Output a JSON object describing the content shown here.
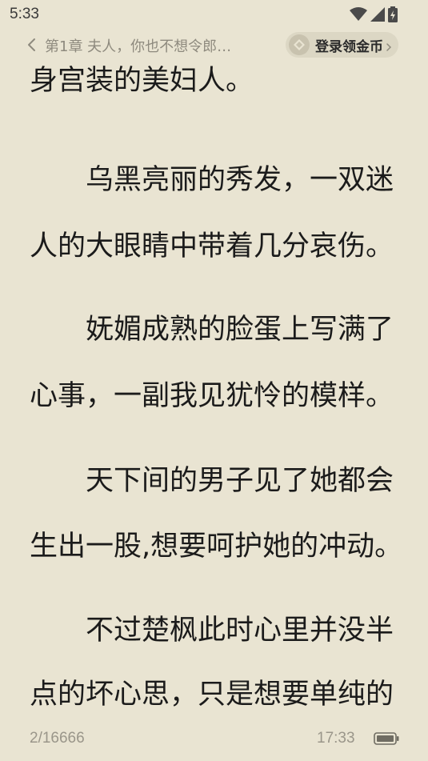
{
  "status_bar": {
    "time": "5:33",
    "icons": [
      "wifi-icon",
      "signal-icon",
      "battery-charging-icon"
    ]
  },
  "header": {
    "chapter_title": "第1章 夫人，你也不想令郎…",
    "login_button": "登录领金币"
  },
  "content": {
    "lines": [
      "身宫装的美妇人。",
      "乌黑亮丽的秀发，一双迷",
      "人的大眼睛中带着几分哀伤。",
      "妩媚成熟的脸蛋上写满了",
      "心事，一副我见犹怜的模样。",
      "天下间的男子见了她都会",
      "生出一股,想要呵护她的冲动。",
      "不过楚枫此时心里并没半",
      "点的坏心思，只是想要单纯的"
    ]
  },
  "footer": {
    "page": "2/16666",
    "time": "17:33"
  },
  "colors": {
    "background": "#e9e4d2",
    "text": "#1b1b1b",
    "muted": "#8e8a7e",
    "pill": "#dcd7c4"
  }
}
